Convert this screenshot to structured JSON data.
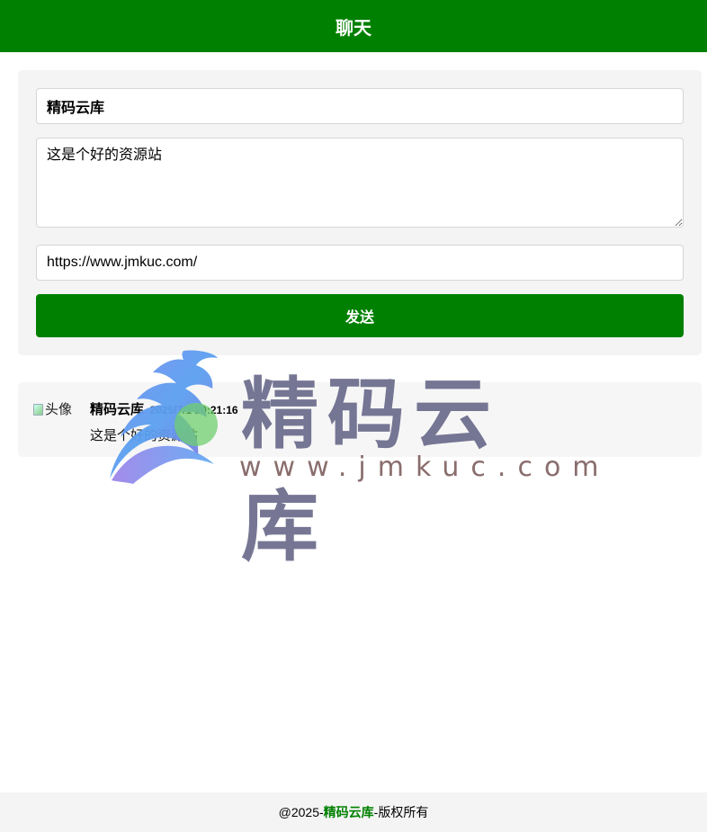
{
  "header": {
    "title": "聊天"
  },
  "form": {
    "name_value": "精码云库",
    "message_value": "这是个好的资源站",
    "url_value": "https://www.jmkuc.com/",
    "send_label": "发送"
  },
  "messages": [
    {
      "avatar_alt": "头像",
      "author": "精码云库",
      "time": "2025/7/1 20:21:16",
      "text": "这是个好的资源站"
    }
  ],
  "watermark": {
    "title": "精码云库",
    "url": "www.jmkuc.com"
  },
  "footer": {
    "prefix": "@2025-",
    "link": "精码云库",
    "suffix": "-版权所有"
  },
  "colors": {
    "brand_green": "#008000",
    "watermark_text": "#6f6f8f",
    "watermark_url": "#8a6d6d"
  }
}
